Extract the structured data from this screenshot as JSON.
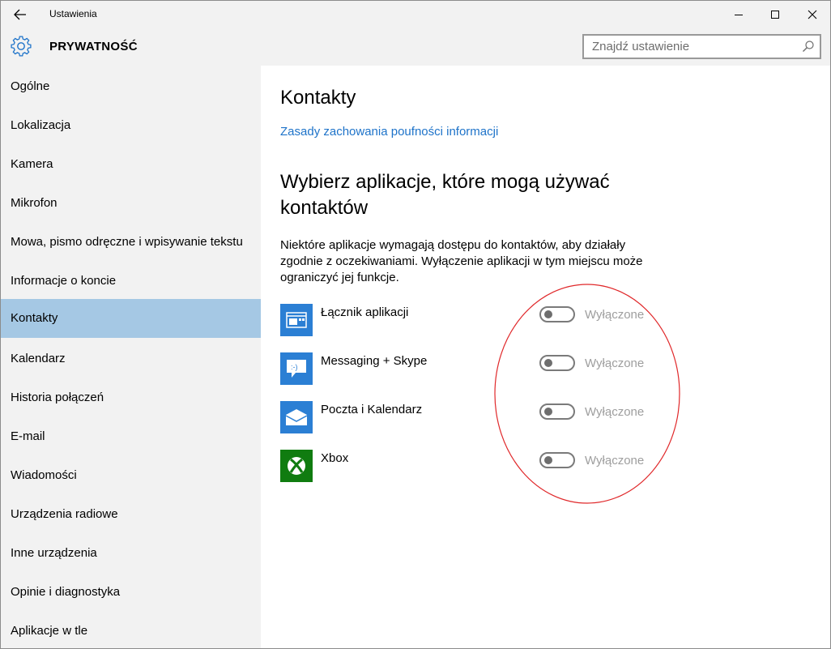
{
  "window": {
    "title": "Ustawienia"
  },
  "header": {
    "title": "PRYWATNOŚĆ",
    "search_placeholder": "Znajdź ustawienie"
  },
  "sidebar": {
    "items": [
      {
        "label": "Ogólne",
        "active": false
      },
      {
        "label": "Lokalizacja",
        "active": false
      },
      {
        "label": "Kamera",
        "active": false
      },
      {
        "label": "Mikrofon",
        "active": false
      },
      {
        "label": "Mowa, pismo odręczne i wpisywanie tekstu",
        "active": false
      },
      {
        "label": "Informacje o koncie",
        "active": false
      },
      {
        "label": "Kontakty",
        "active": true
      },
      {
        "label": "Kalendarz",
        "active": false
      },
      {
        "label": "Historia połączeń",
        "active": false
      },
      {
        "label": "E-mail",
        "active": false
      },
      {
        "label": "Wiadomości",
        "active": false
      },
      {
        "label": "Urządzenia radiowe",
        "active": false
      },
      {
        "label": "Inne urządzenia",
        "active": false
      },
      {
        "label": "Opinie i diagnostyka",
        "active": false
      },
      {
        "label": "Aplikacje w tle",
        "active": false
      }
    ]
  },
  "main": {
    "title": "Kontakty",
    "privacy_link": "Zasady zachowania poufności informacji",
    "section_title": "Wybierz aplikacje, które mogą używać kontaktów",
    "description": "Niektóre aplikacje wymagają dostępu do kontaktów, aby działały zgodnie z oczekiwaniami. Wyłączenie aplikacji w tym miejscu może ograniczyć jej funkcje.",
    "apps": [
      {
        "name": "Łącznik aplikacji",
        "state": "Wyłączone",
        "on": false,
        "icon": "app-connector-icon",
        "color": "#2b7fd4"
      },
      {
        "name": "Messaging + Skype",
        "state": "Wyłączone",
        "on": false,
        "icon": "messaging-icon",
        "color": "#2b7fd4"
      },
      {
        "name": "Poczta i Kalendarz",
        "state": "Wyłączone",
        "on": false,
        "icon": "mail-icon",
        "color": "#2b7fd4"
      },
      {
        "name": "Xbox",
        "state": "Wyłączone",
        "on": false,
        "icon": "xbox-icon",
        "color": "#107c10"
      }
    ]
  },
  "colors": {
    "accent": "#1e73c9",
    "selected": "#a5c8e4",
    "sidebar_bg": "#f2f2f2",
    "annotation": "#e0282a"
  }
}
